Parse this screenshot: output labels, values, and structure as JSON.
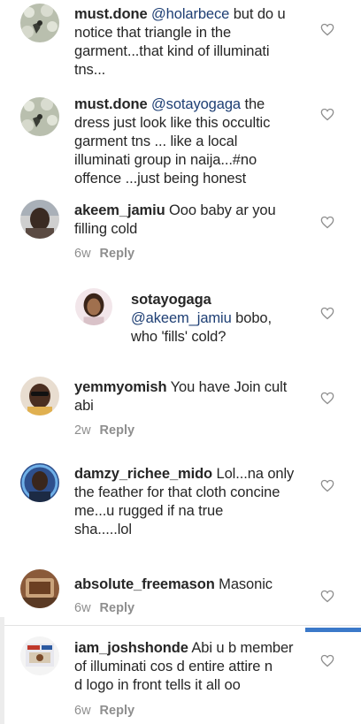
{
  "comments": [
    {
      "username": "must.done",
      "mention": "@holarbece",
      "text_lines": [
        "but do u",
        "notice that triangle in the",
        "garment...that kind of illuminati",
        "tns..."
      ]
    },
    {
      "username": "must.done",
      "mention": "@sotayogaga",
      "text_lines": [
        "the",
        "dress just look like this  occultic",
        "garment tns ... like a local",
        "illuminati group in naija...#no",
        "offence ...just being honest"
      ]
    },
    {
      "username": "akeem_jamiu",
      "text_lines": [
        "Ooo baby ar you",
        "filling cold"
      ],
      "time": "6w",
      "reply": "Reply"
    },
    {
      "username": "sotayogaga",
      "mention": "@akeem_jamiu",
      "text_lines": [
        "bobo,",
        "who 'fills' cold?"
      ]
    },
    {
      "username": "yemmyomish",
      "text_lines": [
        "You have Join cult",
        "abi"
      ],
      "time": "2w",
      "reply": "Reply"
    },
    {
      "username": "damzy_richee_mido",
      "text_lines": [
        "Lol...na only",
        "the feather for that cloth concine",
        "me...u rugged if na true",
        "sha.....lol"
      ]
    },
    {
      "username": "absolute_freemason",
      "text_lines": [
        "Masonic"
      ],
      "time": "6w",
      "reply": "Reply"
    },
    {
      "username": "iam_joshshonde",
      "text_lines": [
        "Abi u b member",
        "of illuminati cos d entire attire n",
        "d logo in front tells it all oo"
      ],
      "time": "6w",
      "reply": "Reply"
    }
  ],
  "colors": {
    "mention": "#1e3f74",
    "meta": "#8e8e8e",
    "accent_bar": "#3b79c9"
  },
  "icons": [
    "heart-outline-icon"
  ]
}
